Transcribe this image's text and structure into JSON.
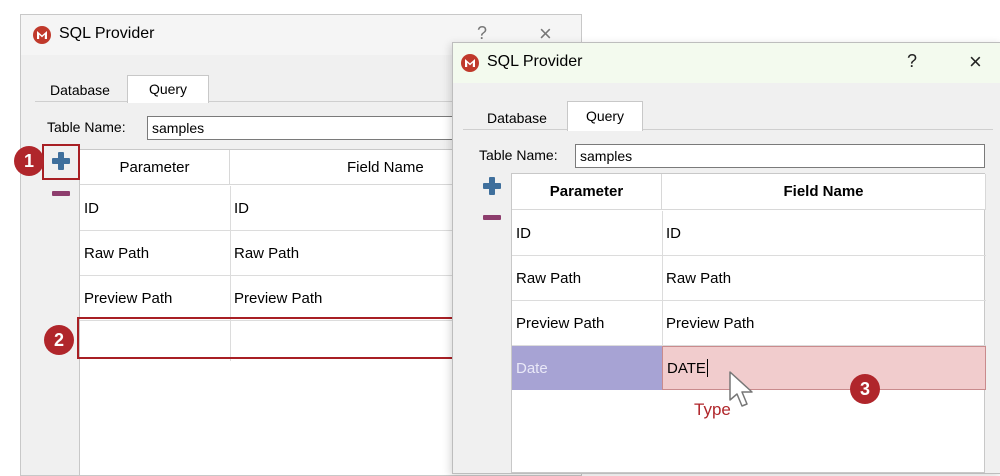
{
  "dialog_back": {
    "title": "SQL Provider",
    "help_label": "?",
    "close_label": "×",
    "tabs": [
      {
        "label": "Database"
      },
      {
        "label": "Query"
      }
    ],
    "table_name_label": "Table Name:",
    "table_name_value": "samples",
    "columns": {
      "parameter": "Parameter",
      "field_name": "Field Name"
    },
    "rows": [
      {
        "parameter": "ID",
        "field_name": "ID"
      },
      {
        "parameter": "Raw Path",
        "field_name": "Raw Path"
      },
      {
        "parameter": "Preview Path",
        "field_name": "Preview Path"
      },
      {
        "parameter": "",
        "field_name": ""
      }
    ]
  },
  "dialog_front": {
    "title": "SQL Provider",
    "help_label": "?",
    "close_label": "×",
    "tabs": [
      {
        "label": "Database"
      },
      {
        "label": "Query"
      }
    ],
    "table_name_label": "Table Name:",
    "table_name_value": "samples",
    "columns": {
      "parameter": "Parameter",
      "field_name": "Field Name"
    },
    "rows": [
      {
        "parameter": "ID",
        "field_name": "ID"
      },
      {
        "parameter": "Raw Path",
        "field_name": "Raw Path"
      },
      {
        "parameter": "Preview Path",
        "field_name": "Preview Path"
      },
      {
        "parameter": "Date",
        "field_name": "DATE"
      }
    ]
  },
  "annotations": {
    "step1": "1",
    "step2": "2",
    "step3": "3",
    "type_hint": "Type"
  },
  "icons": {
    "add": "plus-icon",
    "remove": "minus-icon",
    "app": "app-logo-icon",
    "cursor": "mouse-pointer-icon"
  },
  "colors": {
    "accent_red": "#b0262b",
    "plus_blue": "#3f6f9c",
    "minus_purple": "#8d3d6d",
    "selected_param": "#a7a3d4",
    "selected_field": "#f1cccd"
  }
}
